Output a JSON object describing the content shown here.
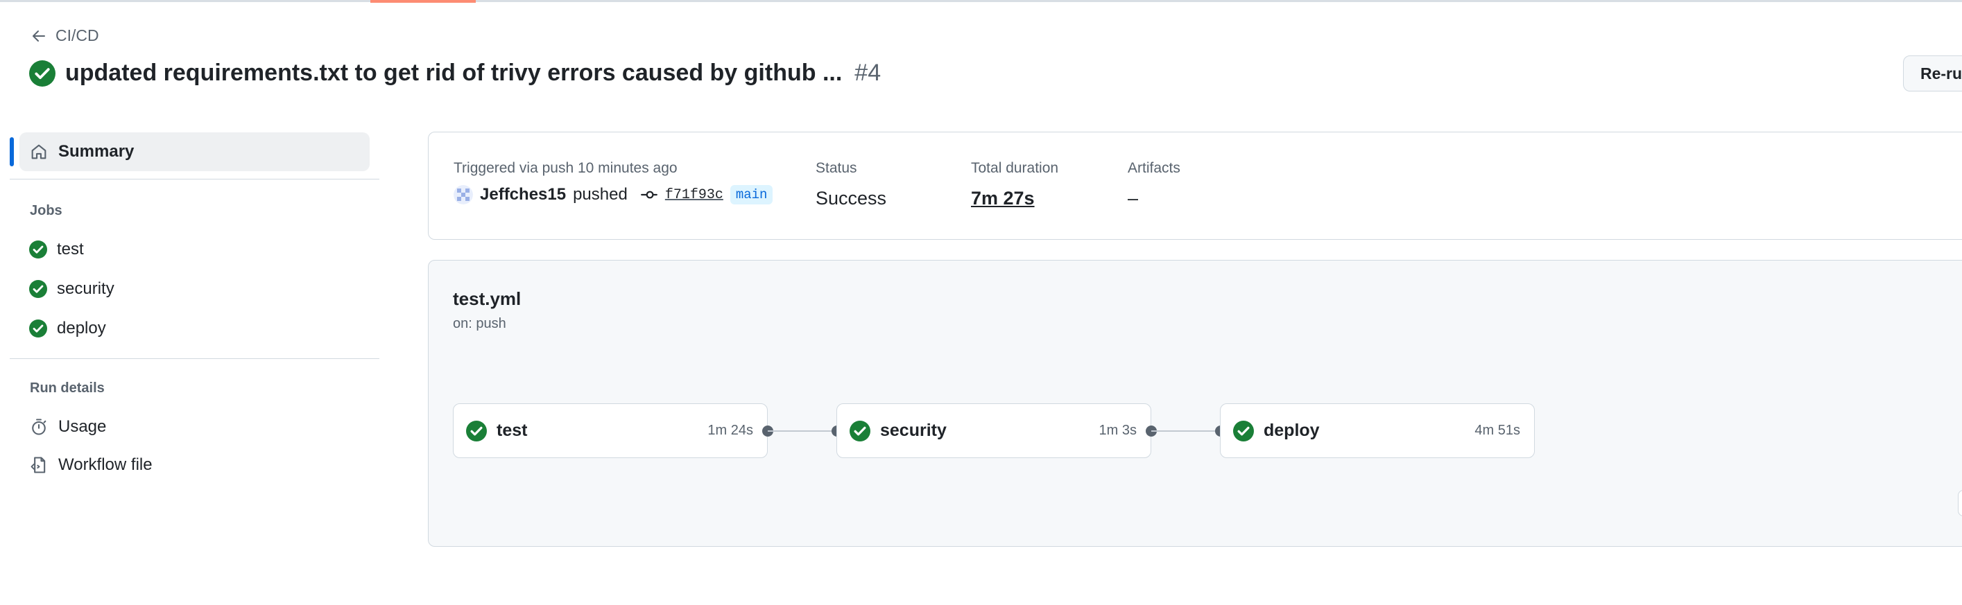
{
  "header": {
    "back_label": "CI/CD",
    "title": "updated requirements.txt to get rid of trivy errors caused by github ...",
    "run_number": "#4",
    "rerun_label": "Re-ru"
  },
  "sidebar": {
    "summary_label": "Summary",
    "jobs_heading": "Jobs",
    "jobs": [
      {
        "label": "test"
      },
      {
        "label": "security"
      },
      {
        "label": "deploy"
      }
    ],
    "run_details_heading": "Run details",
    "details": [
      {
        "label": "Usage"
      },
      {
        "label": "Workflow file"
      }
    ]
  },
  "summary": {
    "trigger_label": "Triggered via push 10 minutes ago",
    "actor": "Jeffches15",
    "action": "pushed",
    "commit_sha": "f71f93c",
    "branch": "main",
    "status_label": "Status",
    "status_value": "Success",
    "duration_label": "Total duration",
    "duration_value": "7m 27s",
    "artifacts_label": "Artifacts",
    "artifacts_value": "–"
  },
  "workflow": {
    "file": "test.yml",
    "trigger": "on: push",
    "jobs": [
      {
        "name": "test",
        "duration": "1m 24s"
      },
      {
        "name": "security",
        "duration": "1m 3s"
      },
      {
        "name": "deploy",
        "duration": "4m 51s"
      }
    ]
  },
  "colors": {
    "success": "#1a7f37",
    "accent": "#0969da",
    "tab_underline": "#fd8c73"
  }
}
